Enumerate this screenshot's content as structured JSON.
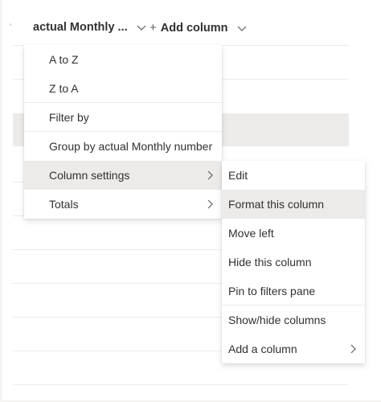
{
  "header": {
    "column_name": "actual Monthly ...",
    "add_column": "Add column",
    "add_column_plus": "+"
  },
  "column_menu": {
    "items": [
      {
        "label": "A to Z"
      },
      {
        "label": "Z to A"
      },
      {
        "label": "Filter by"
      },
      {
        "label": "Group by actual Monthly number"
      },
      {
        "label": "Column settings"
      },
      {
        "label": "Totals"
      }
    ]
  },
  "column_settings_menu": {
    "items": [
      {
        "label": "Edit"
      },
      {
        "label": "Format this column"
      },
      {
        "label": "Move left"
      },
      {
        "label": "Hide this column"
      },
      {
        "label": "Pin to filters pane"
      },
      {
        "label": "Show/hide columns"
      },
      {
        "label": "Add a column"
      }
    ]
  },
  "colors": {
    "text": "#323130",
    "hover_bg": "#edebe9",
    "divider": "#edebe9",
    "icon": "#605e5c"
  },
  "icons": {
    "sort": "sort-indicator-icon",
    "column_dropdown": "chevron-down-icon",
    "add_column_dropdown": "chevron-down-icon",
    "submenu": "chevron-right-icon"
  }
}
